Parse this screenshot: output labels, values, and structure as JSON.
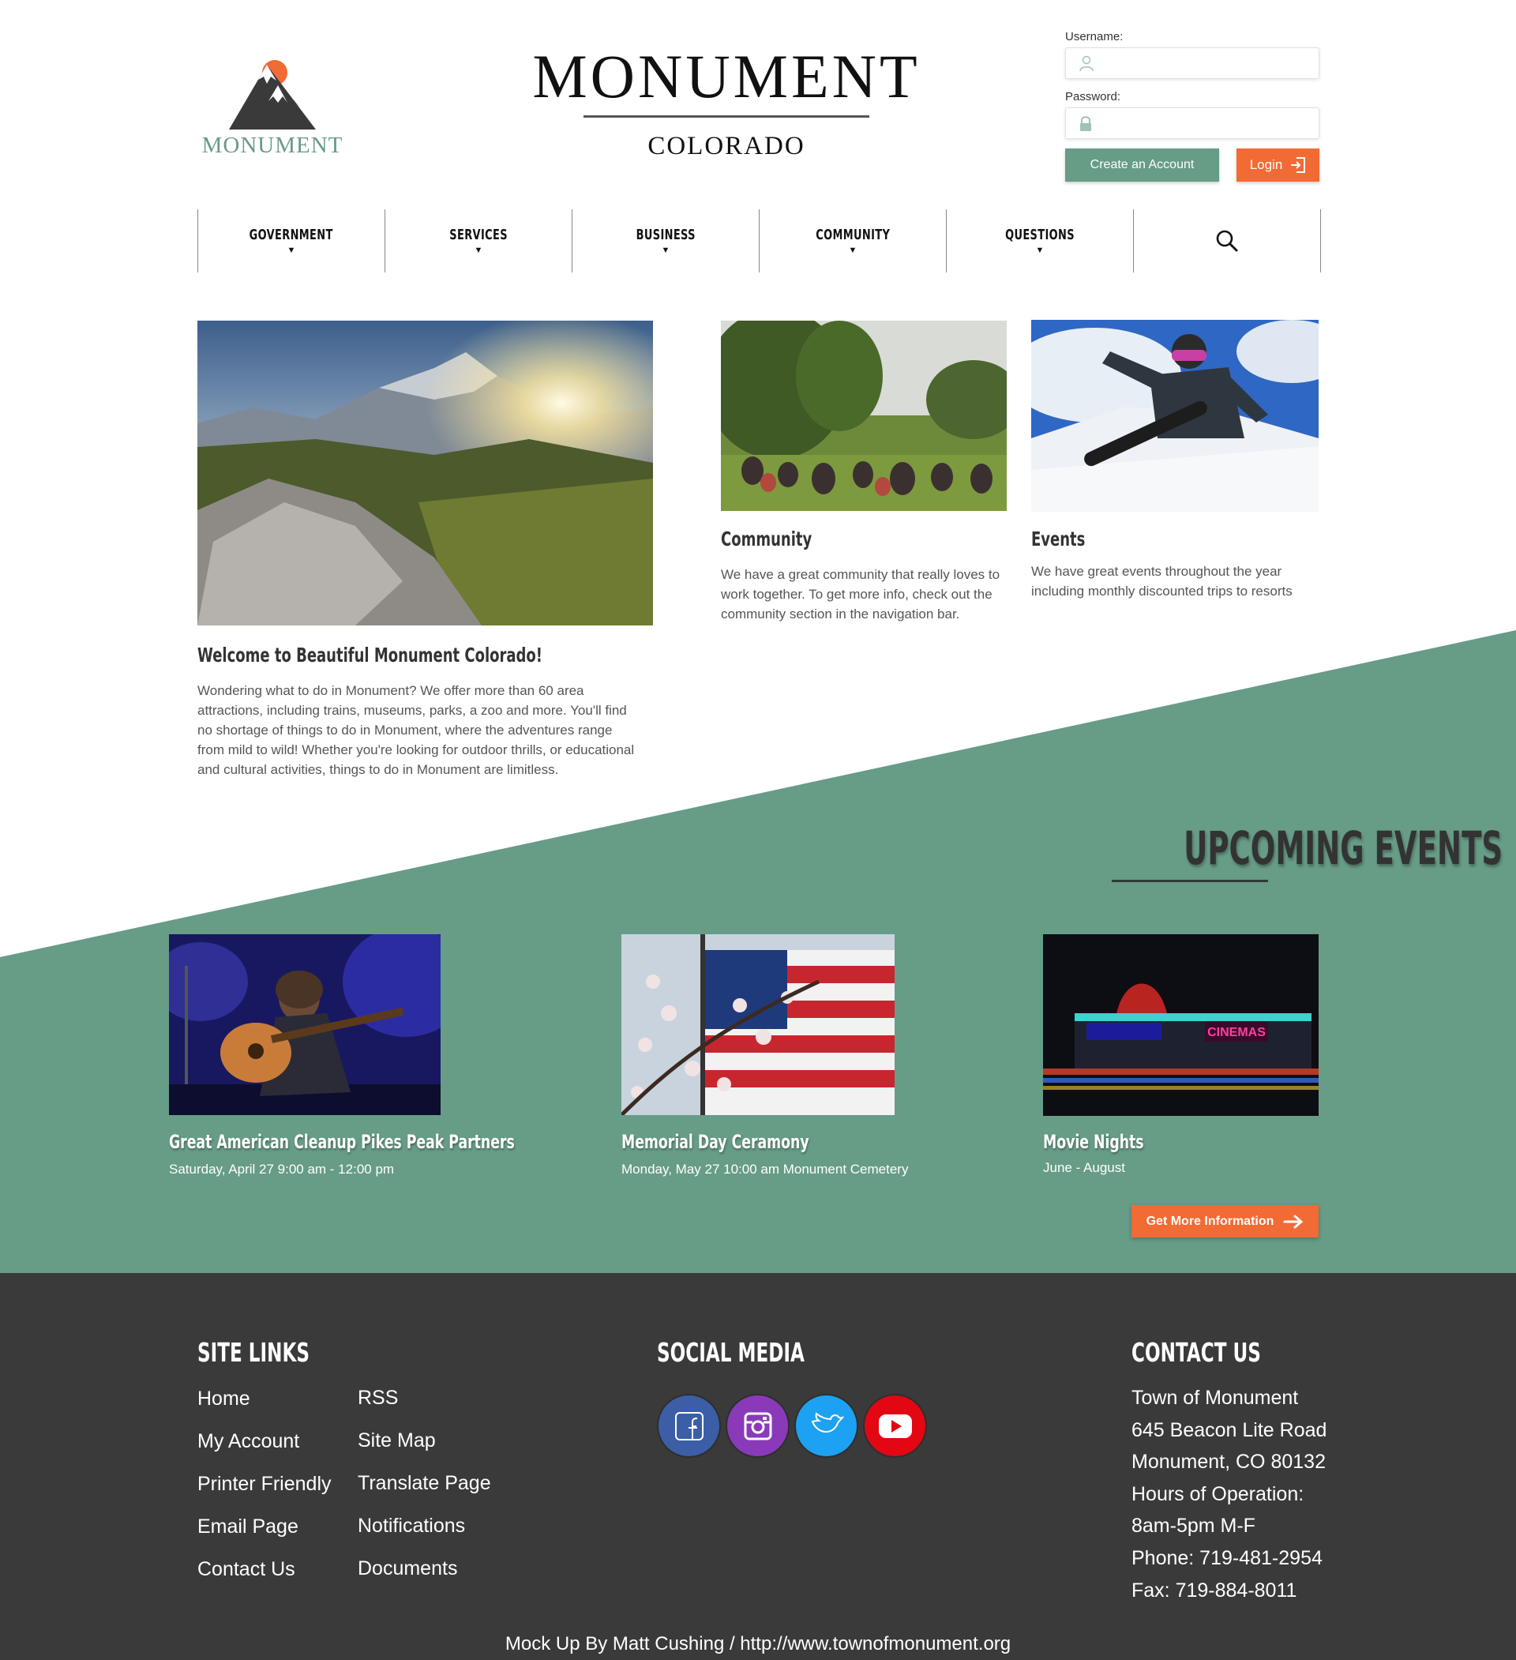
{
  "brand": {
    "logo_text": "MONUMENT",
    "title": "MONUMENT",
    "subtitle": "COLORADO"
  },
  "login": {
    "username_label": "Username:",
    "username_value": "",
    "password_label": "Password:",
    "password_value": "",
    "create_account_label": "Create an Account",
    "login_label": "Login"
  },
  "nav": {
    "items": [
      {
        "label": "GOVERNMENT"
      },
      {
        "label": "SERVICES"
      },
      {
        "label": "BUSINESS"
      },
      {
        "label": "COMMUNITY"
      },
      {
        "label": "QUESTIONS"
      }
    ],
    "search_icon": "search-icon"
  },
  "intro": {
    "welcome_title": "Welcome to Beautiful Monument Colorado!",
    "welcome_body": "Wondering what to do in Monument? We offer more than 60 area attractions, including trains, museums, parks, a zoo and more. You'll find no shortage of things to do in Monument, where the adventures range from mild to wild! Whether you're looking for outdoor thrills, or educational and cultural activities, things to do in Monument are limitless.",
    "community_title": "Community",
    "community_body": "We have a great community that really loves to work together.  To get more info, check out the community section in the navigation bar.",
    "events_title": "Events",
    "events_body": "We have great events throughout the year including monthly discounted trips to resorts"
  },
  "upcoming": {
    "title": "UPCOMING EVENTS",
    "events": [
      {
        "title": "Great American Cleanup Pikes Peak Partners",
        "date": "Saturday, April 27 9:00 am - 12:00 pm"
      },
      {
        "title": "Memorial Day Ceramony",
        "date": "Monday, May 27 10:00 am Monument Cemetery"
      },
      {
        "title": "Movie Nights",
        "date": "June - August"
      }
    ],
    "more_button": "Get More Information",
    "cinema_sign": "CINEMAS"
  },
  "footer": {
    "site_links_title": "SITE LINKS",
    "links_col1": [
      "Home",
      "My Account",
      "Printer Friendly",
      "Email Page",
      "Contact Us"
    ],
    "links_col2": [
      "RSS",
      "Site Map",
      "Translate Page",
      "Notifications",
      "Documents"
    ],
    "social_title": "SOCIAL MEDIA",
    "social": [
      {
        "icon": "facebook-icon",
        "color": "#3b5ea6"
      },
      {
        "icon": "instagram-icon",
        "color": "#8a3ab9"
      },
      {
        "icon": "twitter-icon",
        "color": "#1da1f2"
      },
      {
        "icon": "youtube-icon",
        "color": "#e30613"
      }
    ],
    "contact_title": "CONTACT US",
    "contact_lines": [
      "Town of Monument",
      "645 Beacon Lite Road",
      "Monument, CO 80132",
      "Hours of Operation:",
      "8am-5pm M-F",
      "Phone: 719-481-2954",
      "Fax: 719-884-8011"
    ],
    "credit": "Mock Up By Matt Cushing / http://www.townofmonument.org"
  },
  "colors": {
    "accent_green": "#679c86",
    "accent_orange": "#f26a34",
    "footer_bg": "#3a3a3a"
  }
}
